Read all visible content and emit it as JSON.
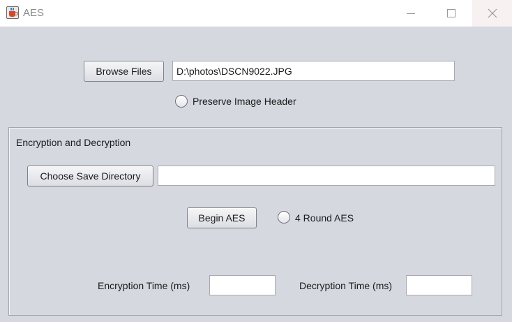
{
  "window": {
    "title": "AES"
  },
  "top": {
    "browse_label": "Browse Files",
    "file_path": "D:\\photos\\DSCN9022.JPG",
    "preserve_header_label": "Preserve Image Header"
  },
  "panel": {
    "title": "Encryption and Decryption",
    "save_dir_label": "Choose Save Directory",
    "save_dir_value": "",
    "begin_label": "Begin AES",
    "four_round_label": "4 Round AES",
    "encryption_time_label": "Encryption Time (ms)",
    "encryption_time_value": "",
    "decryption_time_label": "Decryption Time (ms)",
    "decryption_time_value": ""
  },
  "icons": {
    "app": "java-cup-icon",
    "minimize": "minimize-icon",
    "maximize": "maximize-icon",
    "close": "close-icon"
  }
}
